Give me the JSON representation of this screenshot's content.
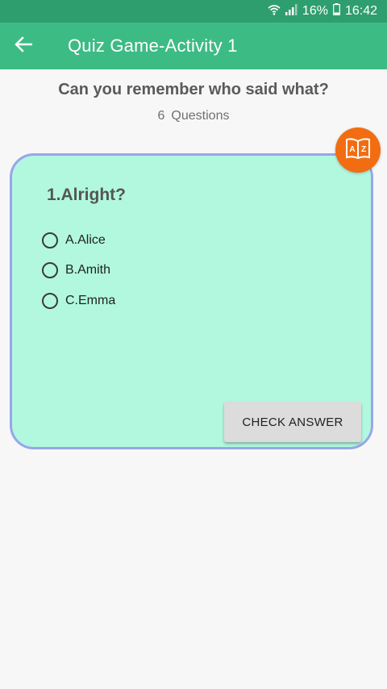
{
  "status_bar": {
    "battery": "16%",
    "time": "16:42",
    "icons": [
      "wifi-icon",
      "signal-icon",
      "battery-icon"
    ]
  },
  "app_bar": {
    "title": "Quiz Game-Activity 1",
    "back_icon": "arrow-left-icon"
  },
  "header": {
    "heading": "Can you remember who said what?",
    "question_count": "6",
    "question_count_label": "Questions"
  },
  "quiz": {
    "badge_icon": "dictionary-book-icon",
    "badge_letters": [
      "A",
      "Z"
    ],
    "question": "1.Alright?",
    "options": [
      {
        "label": "A.Alice",
        "selected": false
      },
      {
        "label": "B.Amith",
        "selected": false
      },
      {
        "label": "C.Emma",
        "selected": false
      }
    ],
    "check_button_label": "CHECK ANSWER"
  },
  "colors": {
    "status_bar": "#2f9e6e",
    "app_bar": "#3dbb84",
    "card_fill": "#b1f8df",
    "card_border": "#98a6ea",
    "badge": "#f26d12",
    "button": "#dcdcdc"
  }
}
